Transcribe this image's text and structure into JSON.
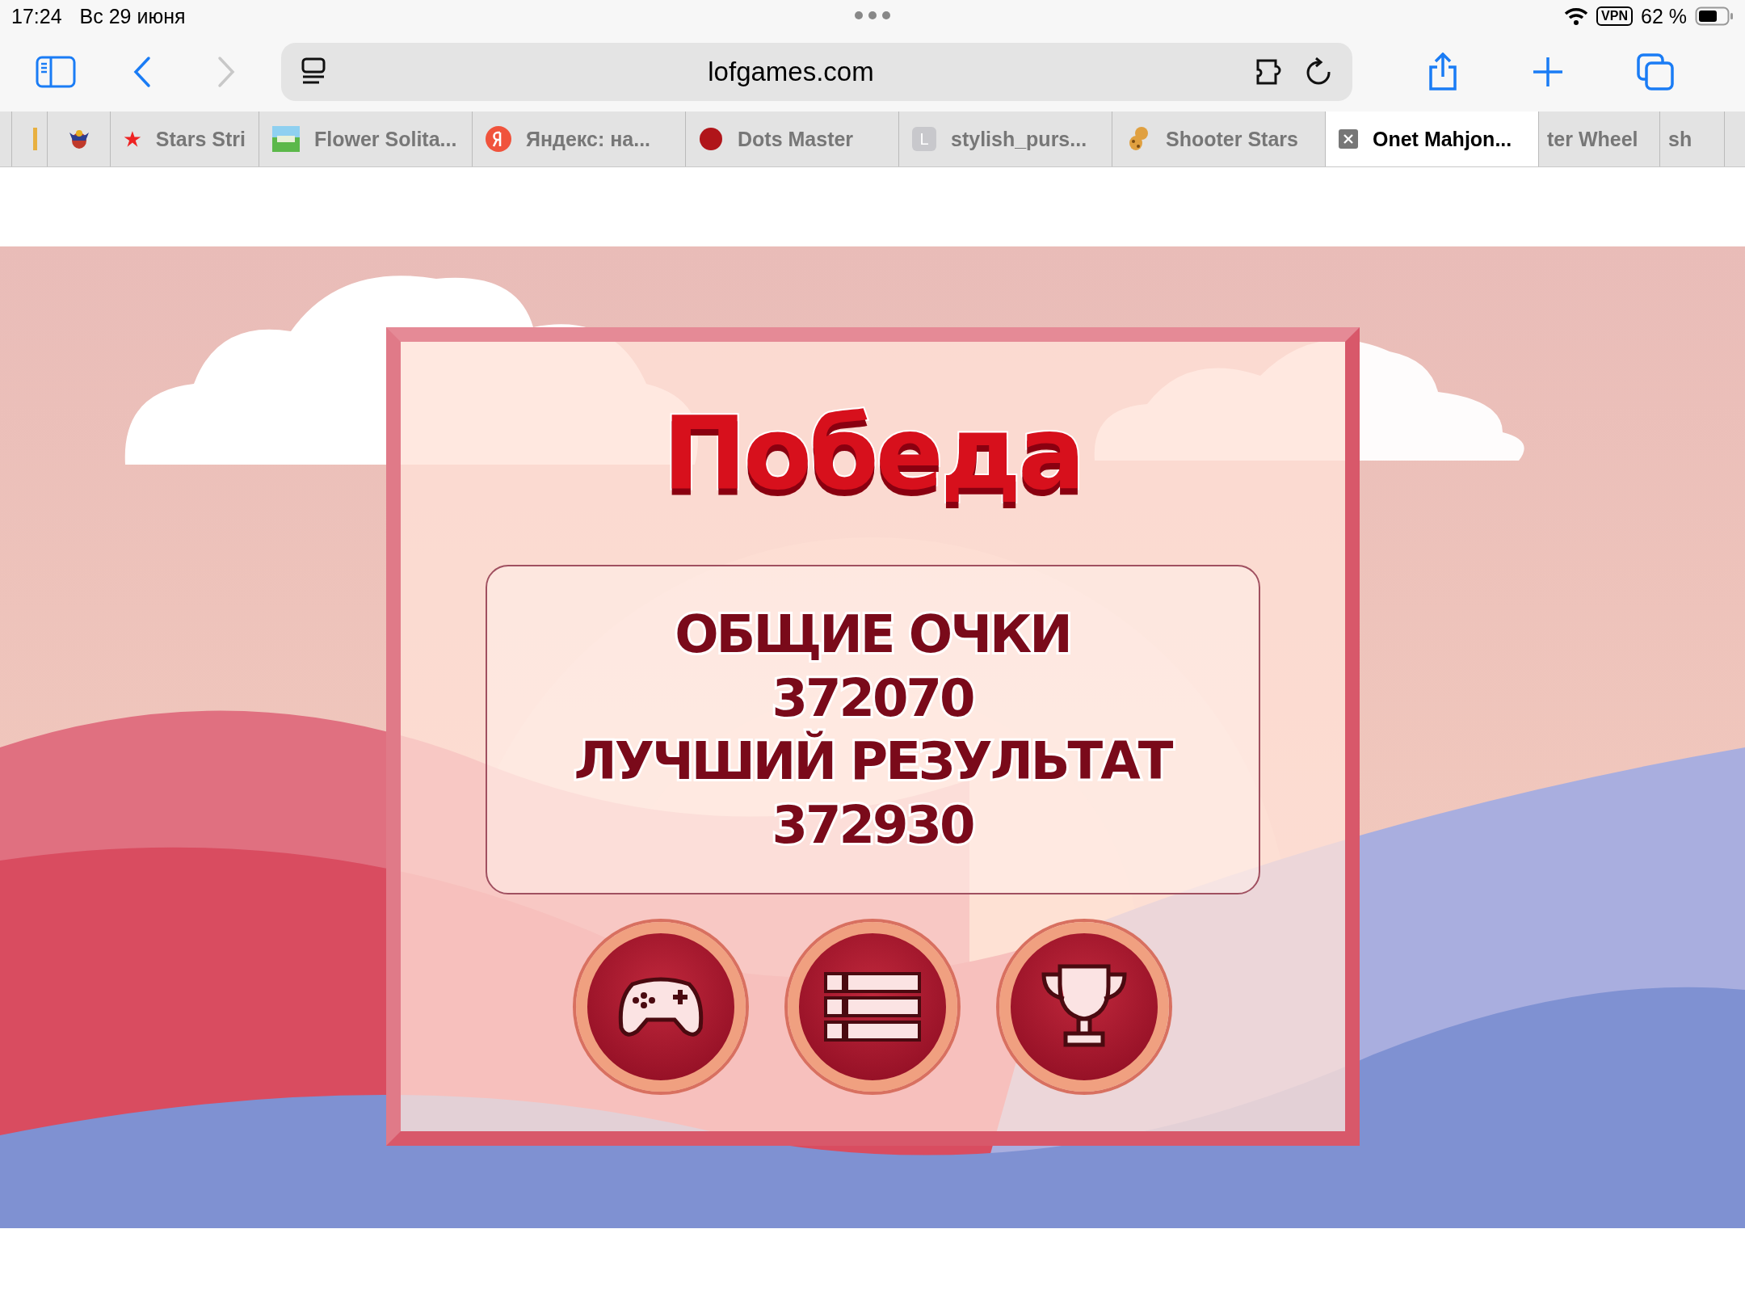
{
  "status_bar": {
    "time": "17:24",
    "date": "Вс 29 июня",
    "vpn": "VPN",
    "battery": "62 %"
  },
  "toolbar": {
    "url": "lofgames.com"
  },
  "tabs": [
    {
      "kind": "sliver",
      "selected": false
    },
    {
      "kind": "emblem",
      "selected": false
    },
    {
      "kind": "star",
      "title": "Stars Stri",
      "selected": false
    },
    {
      "kind": "meadow",
      "title": "Flower Solita...",
      "selected": false
    },
    {
      "kind": "yandex",
      "title": "Яндекс: на...",
      "selected": false
    },
    {
      "kind": "dot",
      "title": "Dots Master",
      "selected": false
    },
    {
      "kind": "letter",
      "letter": "L",
      "title": "stylish_purs...",
      "selected": false
    },
    {
      "kind": "cat",
      "title": "Shooter Stars",
      "selected": false
    },
    {
      "kind": "close",
      "title": "Onet Mahjon...",
      "selected": true
    },
    {
      "kind": "none",
      "title": "ter Wheel",
      "selected": false
    },
    {
      "kind": "none",
      "title": "sh",
      "selected": false
    },
    {
      "kind": "empty",
      "selected": false
    }
  ],
  "dialog": {
    "title": "Победа",
    "stats": [
      {
        "label": "ОБЩИЕ ОЧКИ",
        "value": "372070"
      },
      {
        "label": "ЛУЧШИЙ РЕЗУЛЬТАТ",
        "value": "372930"
      }
    ],
    "buttons": [
      {
        "kind": "gamepad"
      },
      {
        "kind": "list"
      },
      {
        "kind": "trophy"
      }
    ]
  }
}
